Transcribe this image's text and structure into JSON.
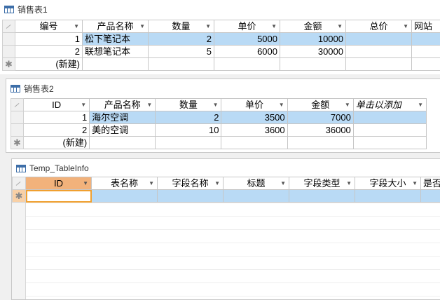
{
  "table1": {
    "title": "销售表1",
    "columns": [
      "编号",
      "产品名称",
      "数量",
      "单价",
      "金额",
      "总价",
      "网站"
    ],
    "rows": [
      [
        "1",
        "松下笔记本",
        "2",
        "5000",
        "10000",
        "",
        ""
      ],
      [
        "2",
        "联想笔记本",
        "5",
        "6000",
        "30000",
        "",
        ""
      ]
    ],
    "new_row": "(新建)"
  },
  "table2": {
    "title": "销售表2",
    "columns": [
      "ID",
      "产品名称",
      "数量",
      "单价",
      "金额",
      "单击以添加"
    ],
    "rows": [
      [
        "1",
        "海尔空调",
        "2",
        "3500",
        "7000",
        ""
      ],
      [
        "2",
        "美的空调",
        "10",
        "3600",
        "36000",
        ""
      ]
    ],
    "new_row": "(新建)"
  },
  "table3": {
    "title": "Temp_TableInfo",
    "columns": [
      "ID",
      "表名称",
      "字段名称",
      "标题",
      "字段类型",
      "字段大小",
      "是否"
    ],
    "new_row_marker": "*"
  },
  "markers": {
    "new_row": "✱"
  }
}
